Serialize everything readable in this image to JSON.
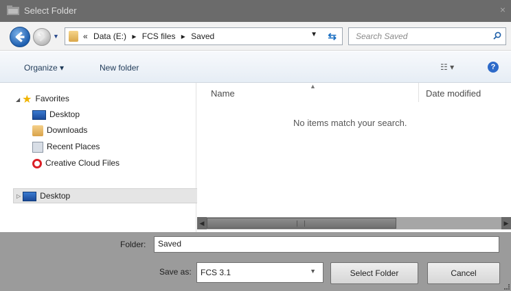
{
  "window": {
    "title": "Select Folder",
    "close_glyph": "×"
  },
  "address": {
    "overflow": "«",
    "path": [
      "Data (E:)",
      "FCS files",
      "Saved"
    ],
    "separator": "▸",
    "search_placeholder": "Search Saved"
  },
  "toolbar": {
    "organize_label": "Organize ▾",
    "new_folder_label": "New folder",
    "views_label": "☷ ▾",
    "help_glyph": "?"
  },
  "nav": {
    "favorites_label": "Favorites",
    "items": [
      "Desktop",
      "Downloads",
      "Recent Places",
      "Creative Cloud Files"
    ],
    "desktop_label": "Desktop"
  },
  "files": {
    "columns": [
      "Name",
      "Date modified"
    ],
    "empty_message": "No items match your search."
  },
  "footer": {
    "folder_label": "Folder:",
    "folder_value": "Saved",
    "save_as_label": "Save as:",
    "save_as_value": "FCS 3.1",
    "select_button": "Select Folder",
    "cancel_button": "Cancel"
  }
}
